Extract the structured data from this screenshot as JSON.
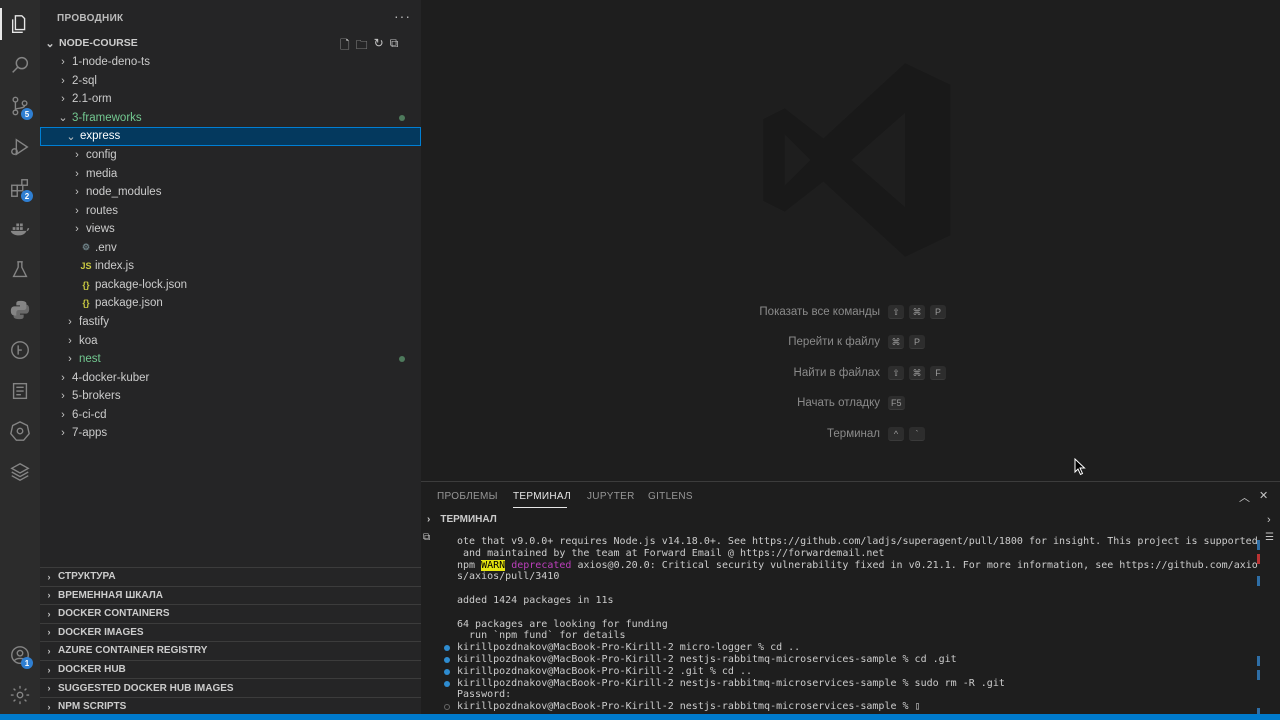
{
  "sidebar": {
    "title": "ПРОВОДНИК",
    "more": "···",
    "root": "NODE-COURSE",
    "tree": [
      {
        "label": "1-node-deno-ts",
        "chev": "›",
        "indent": 0
      },
      {
        "label": "2-sql",
        "chev": "›",
        "indent": 0
      },
      {
        "label": "2.1-orm",
        "chev": "›",
        "indent": 0
      },
      {
        "label": "3-frameworks",
        "chev": "⌄",
        "indent": 0,
        "modified": true
      },
      {
        "label": "express",
        "chev": "⌄",
        "indent": 1,
        "selected": true
      },
      {
        "label": "config",
        "chev": "›",
        "indent": 2
      },
      {
        "label": "media",
        "chev": "›",
        "indent": 2
      },
      {
        "label": "node_modules",
        "chev": "›",
        "indent": 2
      },
      {
        "label": "routes",
        "chev": "›",
        "indent": 2
      },
      {
        "label": "views",
        "chev": "›",
        "indent": 2
      },
      {
        "label": ".env",
        "icon": "⚙",
        "indent": 2
      },
      {
        "label": "index.js",
        "icon": "JS",
        "indent": 2
      },
      {
        "label": "package-lock.json",
        "icon": "{}",
        "indent": 2
      },
      {
        "label": "package.json",
        "icon": "{}",
        "indent": 2
      },
      {
        "label": "fastify",
        "chev": "›",
        "indent": 1
      },
      {
        "label": "koa",
        "chev": "›",
        "indent": 1
      },
      {
        "label": "nest",
        "chev": "›",
        "indent": 1,
        "modified": true
      },
      {
        "label": "4-docker-kuber",
        "chev": "›",
        "indent": 0
      },
      {
        "label": "5-brokers",
        "chev": "›",
        "indent": 0
      },
      {
        "label": "6-ci-cd",
        "chev": "›",
        "indent": 0
      },
      {
        "label": "7-apps",
        "chev": "›",
        "indent": 0
      }
    ],
    "sections": [
      "СТРУКТУРА",
      "ВРЕМЕННАЯ ШКАЛА",
      "DOCKER CONTAINERS",
      "DOCKER IMAGES",
      "AZURE CONTAINER REGISTRY",
      "DOCKER HUB",
      "SUGGESTED DOCKER HUB IMAGES",
      "NPM SCRIPTS"
    ]
  },
  "activity": {
    "badges": {
      "scm": "5",
      "extensions": "2",
      "accounts": "1"
    }
  },
  "editor": {
    "shortcuts": [
      {
        "label": "Показать все команды",
        "keys": [
          "⇧",
          "⌘",
          "P"
        ]
      },
      {
        "label": "Перейти к файлу",
        "keys": [
          "⌘",
          "P"
        ]
      },
      {
        "label": "Найти в файлах",
        "keys": [
          "⇧",
          "⌘",
          "F"
        ]
      },
      {
        "label": "Начать отладку",
        "keys": [
          "F5"
        ]
      },
      {
        "label": "Терминал",
        "keys": [
          "^",
          "`"
        ]
      }
    ]
  },
  "panel": {
    "tabs": [
      "ПРОБЛЕМЫ",
      "ТЕРМИНАЛ",
      "JUPYTER",
      "GITLENS"
    ],
    "active_tab": "ТЕРМИНАЛ",
    "terminal_title": "ТЕРМИНАЛ",
    "lines": [
      {
        "text": "ote that v9.0.0+ requires Node.js v14.18.0+. See https://github.com/ladjs/superagent/pull/1800 for insight. This project is supported"
      },
      {
        "text": " and maintained by the team at Forward Email @ https://forwardemail.net"
      },
      {
        "warn": true,
        "pre": "npm ",
        "tag": "WARN",
        "dep": "deprecated",
        "text": " axios@0.20.0: Critical security vulnerability fixed in v0.21.1. For more information, see https://github.com/axio"
      },
      {
        "text": "s/axios/pull/3410"
      },
      {
        "text": ""
      },
      {
        "text": "added 1424 packages in 11s"
      },
      {
        "text": ""
      },
      {
        "text": "64 packages are looking for funding"
      },
      {
        "text": "  run `npm fund` for details"
      },
      {
        "text": "kirillpozdnakov@MacBook-Pro-Kirill-2 micro-logger % cd ..",
        "dot": "filled"
      },
      {
        "text": "kirillpozdnakov@MacBook-Pro-Kirill-2 nestjs-rabbitmq-microservices-sample % cd .git",
        "dot": "filled"
      },
      {
        "text": "kirillpozdnakov@MacBook-Pro-Kirill-2 .git % cd ..",
        "dot": "filled"
      },
      {
        "text": "kirillpozdnakov@MacBook-Pro-Kirill-2 nestjs-rabbitmq-microservices-sample % sudo rm -R .git",
        "dot": "filled"
      },
      {
        "text": "Password:"
      },
      {
        "text": "kirillpozdnakov@MacBook-Pro-Kirill-2 nestjs-rabbitmq-microservices-sample % ▯",
        "dot": "hollow"
      }
    ]
  }
}
